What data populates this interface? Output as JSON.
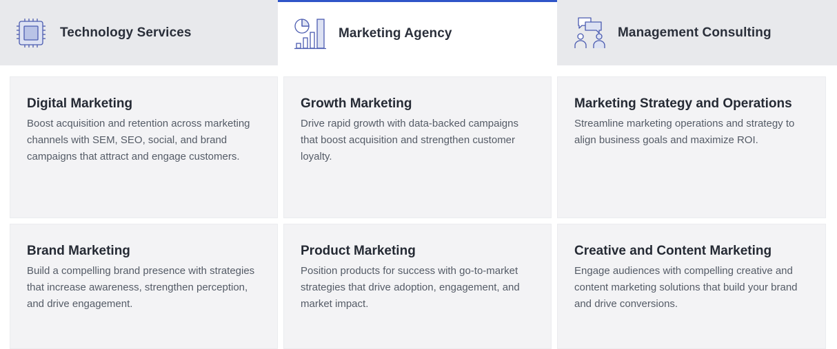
{
  "tabs": [
    {
      "label": "Technology Services",
      "icon": "chip-icon",
      "active": false
    },
    {
      "label": "Marketing Agency",
      "icon": "chart-icon",
      "active": true
    },
    {
      "label": "Management Consulting",
      "icon": "consulting-icon",
      "active": false
    }
  ],
  "cards": [
    {
      "title": "Digital Marketing",
      "description": "Boost acquisition and retention across marketing channels with SEM, SEO, social, and brand campaigns that attract and engage customers."
    },
    {
      "title": "Growth Marketing",
      "description": "Drive rapid growth with data-backed campaigns that boost acquisition and strengthen customer loyalty."
    },
    {
      "title": "Marketing Strategy and Operations",
      "description": "Streamline marketing operations and strategy to align business goals and maximize ROI."
    },
    {
      "title": "Brand Marketing",
      "description": "Build a compelling brand presence with strategies that increase awareness, strengthen perception, and drive engagement."
    },
    {
      "title": "Product Marketing",
      "description": "Position products for success with go-to-market strategies that drive adoption, engagement, and market impact."
    },
    {
      "title": "Creative and Content Marketing",
      "description": "Engage audiences with compelling creative and content marketing solutions that build your brand and drive conversions."
    }
  ],
  "colors": {
    "active_tab_border": "#2f55c8",
    "inactive_tab_bg": "#e8e9ec",
    "card_bg": "#f3f3f5",
    "icon_stroke": "#4a5bb0",
    "icon_fill": "#dde2f3"
  }
}
